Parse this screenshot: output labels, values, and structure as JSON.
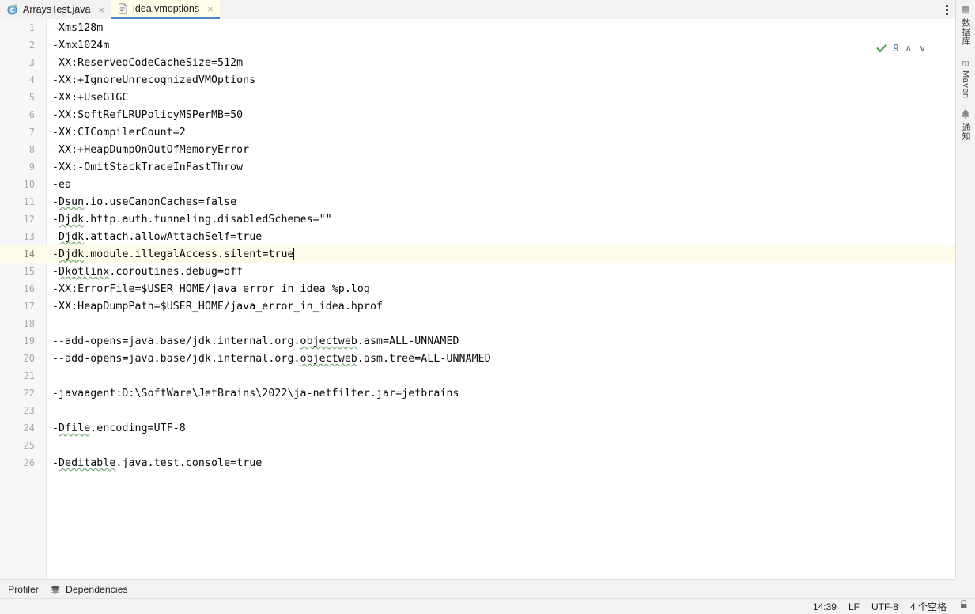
{
  "tabs": [
    {
      "label": "ArraysTest.java",
      "icon": "java-class-icon",
      "close": "×",
      "active": false
    },
    {
      "label": "idea.vmoptions",
      "icon": "file-text-icon",
      "close": "×",
      "active": true
    }
  ],
  "tabbar": {
    "kebab_name": "more-options-icon"
  },
  "editor": {
    "filename": "idea.vmoptions",
    "caret_line": 14,
    "lines": [
      {
        "n": "1",
        "text": "-Xms128m"
      },
      {
        "n": "2",
        "text": "-Xmx1024m"
      },
      {
        "n": "3",
        "text": "-XX:ReservedCodeCacheSize=512m"
      },
      {
        "n": "4",
        "text": "-XX:+IgnoreUnrecognizedVMOptions"
      },
      {
        "n": "5",
        "text": "-XX:+UseG1GC"
      },
      {
        "n": "6",
        "text": "-XX:SoftRefLRUPolicyMSPerMB=50"
      },
      {
        "n": "7",
        "text": "-XX:CICompilerCount=2"
      },
      {
        "n": "8",
        "text": "-XX:+HeapDumpOnOutOfMemoryError"
      },
      {
        "n": "9",
        "text": "-XX:-OmitStackTraceInFastThrow"
      },
      {
        "n": "10",
        "text": "-ea"
      },
      {
        "n": "11",
        "text": "-Dsun.io.useCanonCaches=false",
        "warn": "Dsun"
      },
      {
        "n": "12",
        "text": "-Djdk.http.auth.tunneling.disabledSchemes=\"\"",
        "warn": "Djdk"
      },
      {
        "n": "13",
        "text": "-Djdk.attach.allowAttachSelf=true",
        "warn": "Djdk"
      },
      {
        "n": "14",
        "text": "-Djdk.module.illegalAccess.silent=true",
        "warn": "Djdk",
        "current": true,
        "caret": true
      },
      {
        "n": "15",
        "text": "-Dkotlinx.coroutines.debug=off",
        "warn": "Dkotlinx"
      },
      {
        "n": "16",
        "text": "-XX:ErrorFile=$USER_HOME/java_error_in_idea_%p.log"
      },
      {
        "n": "17",
        "text": "-XX:HeapDumpPath=$USER_HOME/java_error_in_idea.hprof"
      },
      {
        "n": "18",
        "text": ""
      },
      {
        "n": "19",
        "text": "--add-opens=java.base/jdk.internal.org.objectweb.asm=ALL-UNNAMED",
        "warn": "objectweb"
      },
      {
        "n": "20",
        "text": "--add-opens=java.base/jdk.internal.org.objectweb.asm.tree=ALL-UNNAMED",
        "warn": "objectweb"
      },
      {
        "n": "21",
        "text": ""
      },
      {
        "n": "22",
        "text": "-javaagent:D:\\SoftWare\\JetBrains\\2022\\ja-netfilter.jar=jetbrains"
      },
      {
        "n": "23",
        "text": ""
      },
      {
        "n": "24",
        "text": "-Dfile.encoding=UTF-8",
        "warn": "Dfile"
      },
      {
        "n": "25",
        "text": ""
      },
      {
        "n": "26",
        "text": "-Deditable.java.test.console=true",
        "warn": "Deditable"
      }
    ]
  },
  "inspection_widget": {
    "status_icon": "green-check-icon",
    "count": "9",
    "prev_icon": "chevron-up-icon",
    "next_icon": "chevron-down-icon",
    "prev_glyph": "∧",
    "next_glyph": "∨"
  },
  "right_tool_strip": [
    {
      "label": "数据库",
      "icon": "database-icon",
      "latin": false
    },
    {
      "label": "Maven",
      "icon": "maven-icon",
      "latin": true
    },
    {
      "label": "通知",
      "icon": "bell-icon",
      "latin": false
    }
  ],
  "bottom_bar": [
    {
      "label": "Profiler",
      "icon": null
    },
    {
      "label": "Dependencies",
      "icon": "layers-icon"
    }
  ],
  "status_bar": {
    "position": "14:39",
    "line_separator": "LF",
    "encoding": "UTF-8",
    "indent": "4 个空格",
    "lock_icon": "lock-icon"
  },
  "colors": {
    "active_tab_bg": "#fffce8",
    "active_tab_underline": "#4a86c8",
    "current_line_bg": "#fcfae8",
    "gutter_bg": "#f7f7f7",
    "chrome_bg": "#f2f2f2",
    "editor_bg": "#ffffff",
    "warning_squiggle": "#7fb37f",
    "check_green": "#3b7a3b",
    "count_blue": "#2b6cb0"
  }
}
